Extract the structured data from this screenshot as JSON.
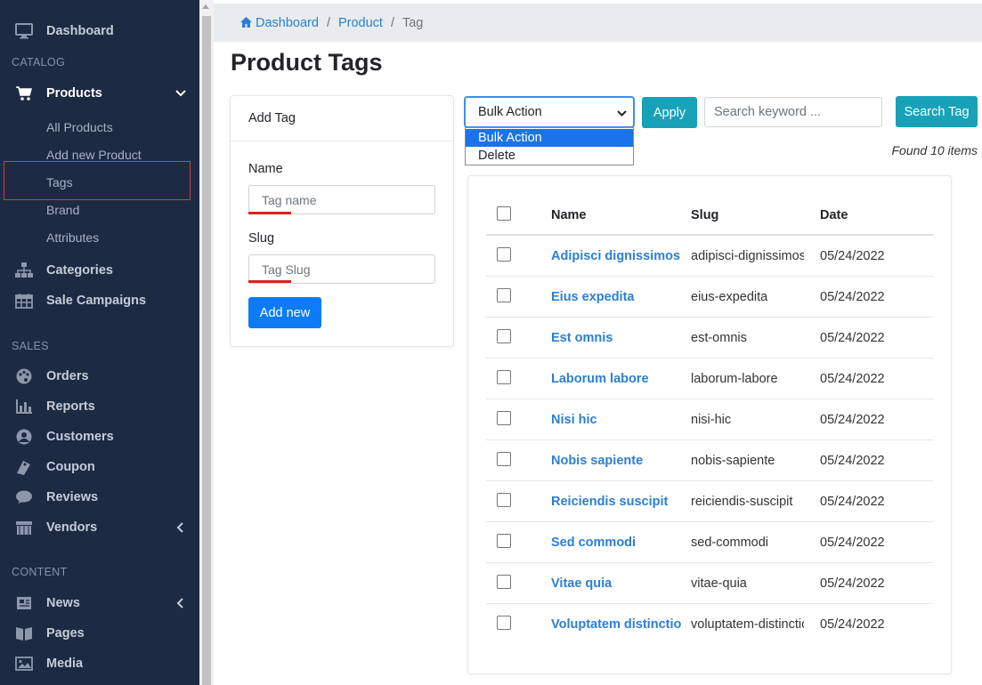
{
  "sidebar": {
    "dashboard": "Dashboard",
    "catalog_head": "CATALOG",
    "products": "Products",
    "products_sub": [
      "All Products",
      "Add new Product",
      "Tags",
      "Brand",
      "Attributes"
    ],
    "categories": "Categories",
    "sale_campaigns": "Sale Campaigns",
    "sales_head": "SALES",
    "orders": "Orders",
    "reports": "Reports",
    "customers": "Customers",
    "coupon": "Coupon",
    "reviews": "Reviews",
    "vendors": "Vendors",
    "content_head": "CONTENT",
    "news": "News",
    "pages": "Pages",
    "media": "Media"
  },
  "breadcrumb": {
    "home": "Dashboard",
    "section": "Product",
    "current": "Tag",
    "separator": "/"
  },
  "page_title": "Product Tags",
  "add_tag": {
    "title": "Add Tag",
    "name_label": "Name",
    "name_placeholder": "Tag name",
    "slug_label": "Slug",
    "slug_placeholder": "Tag Slug",
    "submit": "Add new"
  },
  "toolbar": {
    "bulk_selected": "Bulk Action",
    "bulk_options": [
      "Bulk Action",
      "Delete"
    ],
    "apply": "Apply",
    "search_placeholder": "Search keyword ...",
    "search_button": "Search Tag",
    "found": "Found 10 items"
  },
  "table": {
    "columns": [
      "Name",
      "Slug",
      "Date"
    ],
    "rows": [
      {
        "name": "Adipisci dignissimos",
        "slug": "adipisci-dignissimos",
        "date": "05/24/2022"
      },
      {
        "name": "Eius expedita",
        "slug": "eius-expedita",
        "date": "05/24/2022"
      },
      {
        "name": "Est omnis",
        "slug": "est-omnis",
        "date": "05/24/2022"
      },
      {
        "name": "Laborum labore",
        "slug": "laborum-labore",
        "date": "05/24/2022"
      },
      {
        "name": "Nisi hic",
        "slug": "nisi-hic",
        "date": "05/24/2022"
      },
      {
        "name": "Nobis sapiente",
        "slug": "nobis-sapiente",
        "date": "05/24/2022"
      },
      {
        "name": "Reiciendis suscipit",
        "slug": "reiciendis-suscipit",
        "date": "05/24/2022"
      },
      {
        "name": "Sed commodi",
        "slug": "sed-commodi",
        "date": "05/24/2022"
      },
      {
        "name": "Vitae quia",
        "slug": "vitae-quia",
        "date": "05/24/2022"
      },
      {
        "name": "Voluptatem distinctio",
        "slug": "voluptatem-distinctio",
        "date": "05/24/2022"
      }
    ]
  },
  "colors": {
    "sidebar_bg": "#1d2a44",
    "link": "#2b7fd4",
    "primary": "#0d7bf5",
    "teal": "#17a2b8",
    "highlight": "#e03a3a"
  },
  "icons": {
    "dashboard": "monitor-icon",
    "products": "cart-icon",
    "categories": "sitemap-icon",
    "sale_campaigns": "calendar-icon",
    "orders": "palette-icon",
    "reports": "bar-chart-icon",
    "customers": "user-circle-icon",
    "coupon": "tag-icon",
    "reviews": "comment-icon",
    "vendors": "store-icon",
    "news": "newspaper-icon",
    "pages": "book-icon",
    "media": "image-icon"
  }
}
